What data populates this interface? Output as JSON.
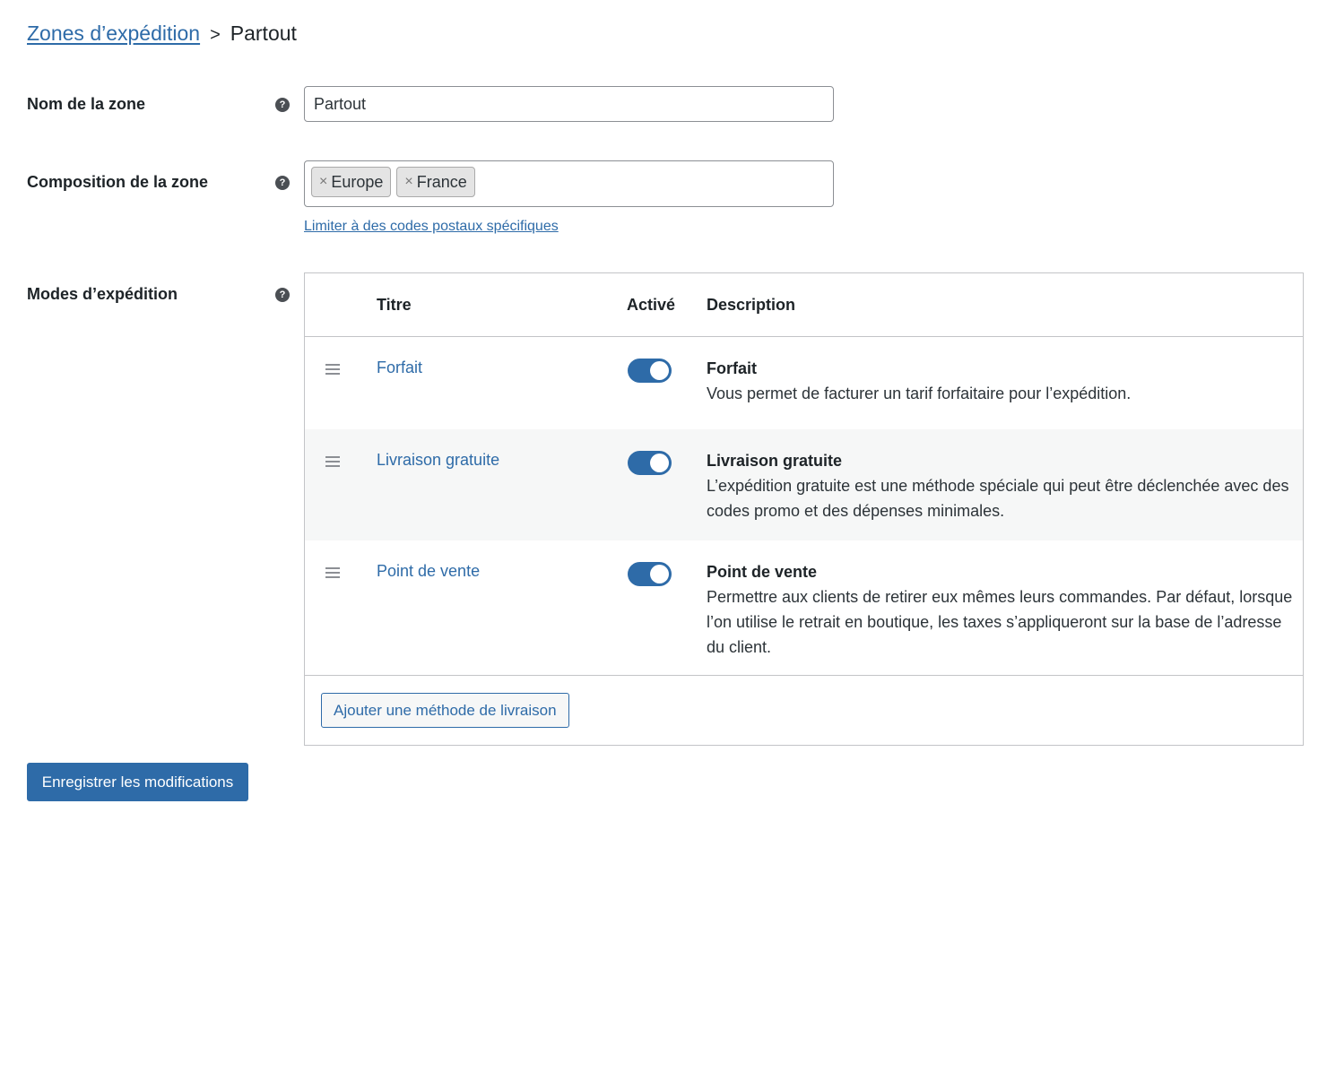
{
  "breadcrumb": {
    "parent": "Zones d’expédition",
    "separator": ">",
    "current": "Partout"
  },
  "zone_name": {
    "label": "Nom de la zone",
    "help_icon": "question-circle-icon",
    "value": "Partout"
  },
  "zone_regions": {
    "label": "Composition de la zone",
    "help_icon": "question-circle-icon",
    "tokens": [
      {
        "remove": "×",
        "label": "Europe"
      },
      {
        "remove": "×",
        "label": "France"
      }
    ],
    "postcode_link": "Limiter à des codes postaux spécifiques"
  },
  "shipping_methods": {
    "label": "Modes d’expédition",
    "help_icon": "question-circle-icon",
    "columns": {
      "title": "Titre",
      "enabled": "Activé",
      "description": "Description"
    },
    "rows": [
      {
        "title": "Forfait",
        "enabled": true,
        "desc_title": "Forfait",
        "desc_text": "Vous permet de facturer un tarif forfaitaire pour l’expédition."
      },
      {
        "title": "Livraison gratuite",
        "enabled": true,
        "desc_title": "Livraison gratuite",
        "desc_text": "L’expédition gratuite est une méthode spéciale qui peut être déclenchée avec des codes promo et des dépenses minimales."
      },
      {
        "title": "Point de vente",
        "enabled": true,
        "desc_title": "Point de vente",
        "desc_text": "Permettre aux clients de retirer eux mêmes leurs commandes. Par défaut, lorsque l’on utilise le retrait en boutique, les taxes s’appliqueront sur la base de l’adresse du client."
      }
    ],
    "add_button": "Ajouter une méthode de livraison"
  },
  "save_button": "Enregistrer les modifications",
  "colors": {
    "accent": "#2e6ba8",
    "text": "#1d2327",
    "border": "#c3c4c7",
    "alt_row": "#f6f7f7"
  }
}
